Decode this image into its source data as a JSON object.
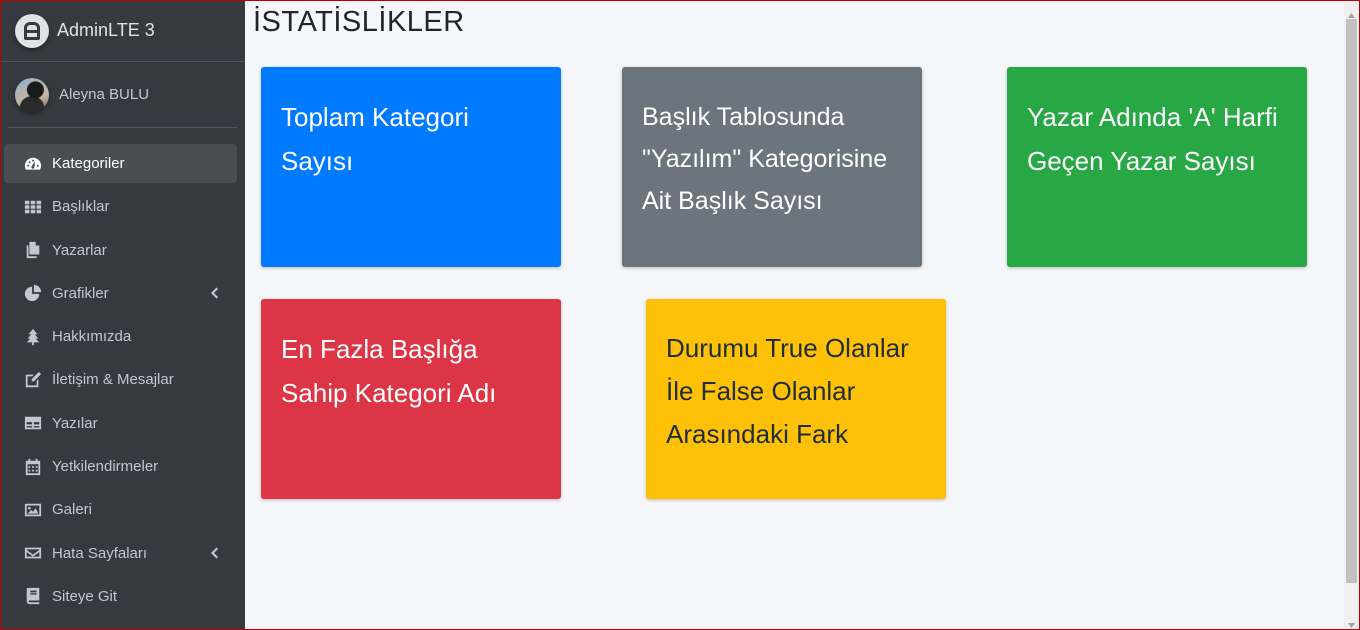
{
  "brand": {
    "name": "AdminLTE 3"
  },
  "user": {
    "name": "Aleyna BULU"
  },
  "nav": [
    {
      "label": "Kategoriler",
      "icon": "tachometer-icon",
      "active": true
    },
    {
      "label": "Başlıklar",
      "icon": "th-grid-icon"
    },
    {
      "label": "Yazarlar",
      "icon": "copy-icon"
    },
    {
      "label": "Grafikler",
      "icon": "chart-pie-icon",
      "has_children": true
    },
    {
      "label": "Hakkımızda",
      "icon": "tree-icon"
    },
    {
      "label": "İletişim & Mesajlar",
      "icon": "edit-icon"
    },
    {
      "label": "Yazılar",
      "icon": "table-icon"
    },
    {
      "label": "Yetkilendirmeler",
      "icon": "calendar-icon"
    },
    {
      "label": "Galeri",
      "icon": "image-icon"
    },
    {
      "label": "Hata Sayfaları",
      "icon": "envelope-icon",
      "has_children": true
    },
    {
      "label": "Siteye Git",
      "icon": "book-icon"
    }
  ],
  "page": {
    "title": "İSTATİSLİKLER"
  },
  "cards": [
    {
      "text": "Toplam Kategori Sayısı",
      "color": "#007bff"
    },
    {
      "text": "Başlık Tablosunda \"Yazılım\" Kategorisine Ait Başlık Sayısı",
      "color": "#6c757d"
    },
    {
      "text": "Yazar Adında 'A' Harfi Geçen Yazar Sayısı",
      "color": "#28a745"
    },
    {
      "text": "En Fazla Başlığa Sahip Kategori Adı",
      "color": "#dc3545"
    },
    {
      "text": "Durumu True Olanlar İle False Olanlar Arasındaki Fark",
      "color": "#ffc107"
    }
  ]
}
